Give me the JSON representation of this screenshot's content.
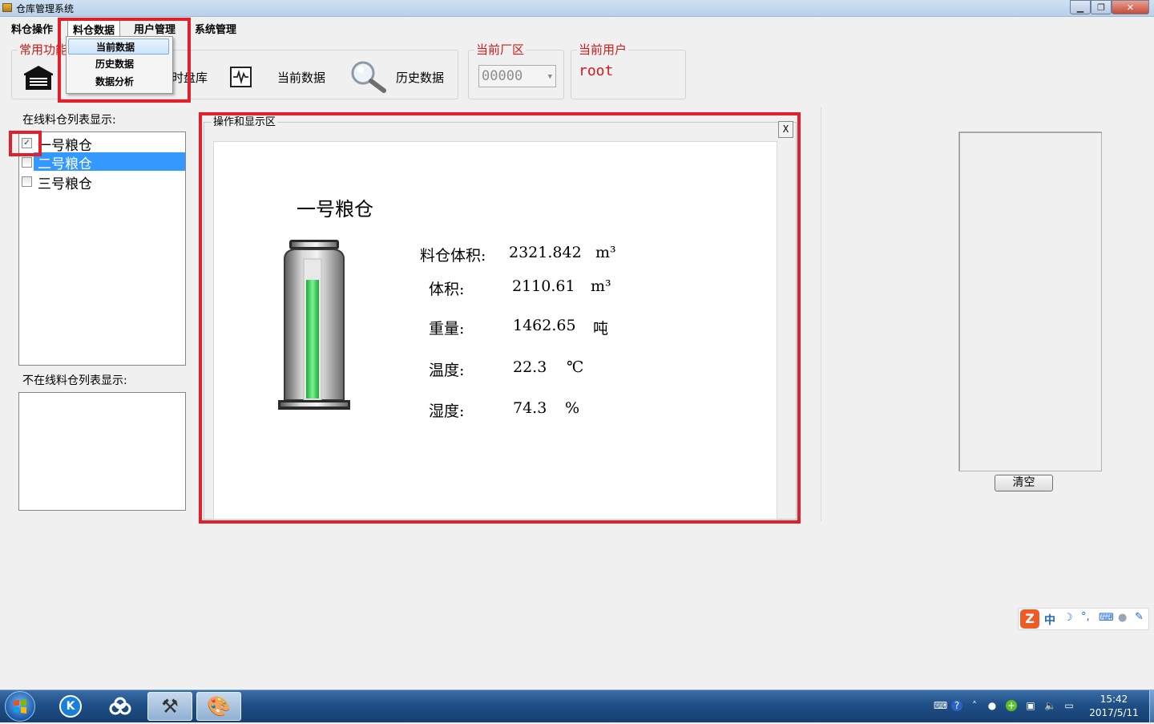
{
  "window": {
    "title": "仓库管理系统"
  },
  "menubar": {
    "items": [
      "料仓操作",
      "料仓数据",
      "用户管理",
      "系统管理"
    ]
  },
  "dropdown": {
    "items": [
      "当前数据",
      "历史数据",
      "数据分析"
    ],
    "selected": "当前数据"
  },
  "toolbar": {
    "group_label": "常用功能",
    "partial_label": "时盘库",
    "current_data_label": "当前数据",
    "history_data_label": "历史数据",
    "factory_label": "当前厂区",
    "factory_value": "00000",
    "user_label": "当前用户",
    "user_value": "root"
  },
  "left": {
    "online_label": "在线料仓列表显示:",
    "online_items": [
      {
        "label": "一号粮仓",
        "checked": true,
        "selected": false
      },
      {
        "label": "二号粮仓",
        "checked": false,
        "selected": true
      },
      {
        "label": "三号粮仓",
        "checked": false,
        "selected": false
      }
    ],
    "offline_label": "不在线料仓列表显示:"
  },
  "panel": {
    "title": "操作和显示区",
    "close_label": "X",
    "silo_name": "一号粮仓",
    "rows": [
      {
        "label": "料仓体积:",
        "value": "2321.842",
        "unit": "m³"
      },
      {
        "label": "体积:",
        "value": "2110.61",
        "unit": "m³"
      },
      {
        "label": "重量:",
        "value": "1462.65",
        "unit": "吨"
      },
      {
        "label": "温度:",
        "value": "22.3",
        "unit": "℃"
      },
      {
        "label": "湿度:",
        "value": "74.3",
        "unit": "%"
      }
    ],
    "fill_level": 0.86
  },
  "right": {
    "clear_label": "清空"
  },
  "ime": {
    "mode": "中"
  },
  "taskbar": {
    "time": "15:42",
    "date": "2017/5/11"
  },
  "colors": {
    "highlight_red": "#e0202a",
    "label_red": "#d41a1a",
    "selection_blue": "#3399ff",
    "gauge_green": "#3fd35c"
  }
}
